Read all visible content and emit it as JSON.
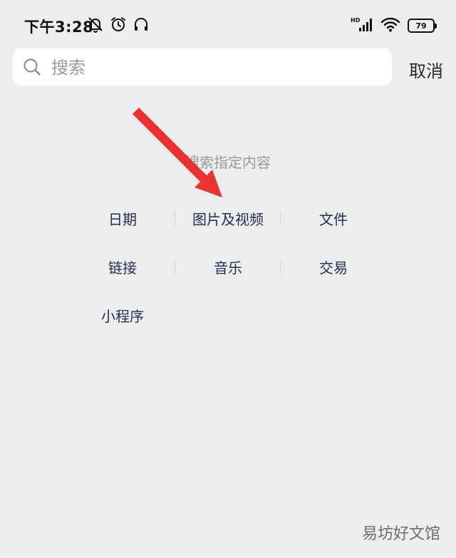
{
  "status_bar": {
    "time": "下午3:28",
    "icons": [
      "notifications-muted-icon",
      "alarm-icon",
      "headphones-icon"
    ],
    "right_icons": [
      "hd-signal-icon",
      "wifi-icon",
      "battery-icon"
    ],
    "battery_level": "79"
  },
  "search": {
    "placeholder": "搜索",
    "value": "",
    "cancel_label": "取消"
  },
  "section": {
    "title": "搜索指定内容"
  },
  "categories": [
    {
      "label": "日期"
    },
    {
      "label": "图片及视频"
    },
    {
      "label": "文件"
    },
    {
      "label": "链接"
    },
    {
      "label": "音乐"
    },
    {
      "label": "交易"
    },
    {
      "label": "小程序"
    }
  ],
  "annotation": {
    "arrow_color": "#e8332e"
  },
  "watermark": {
    "text": "易坊好文馆"
  }
}
